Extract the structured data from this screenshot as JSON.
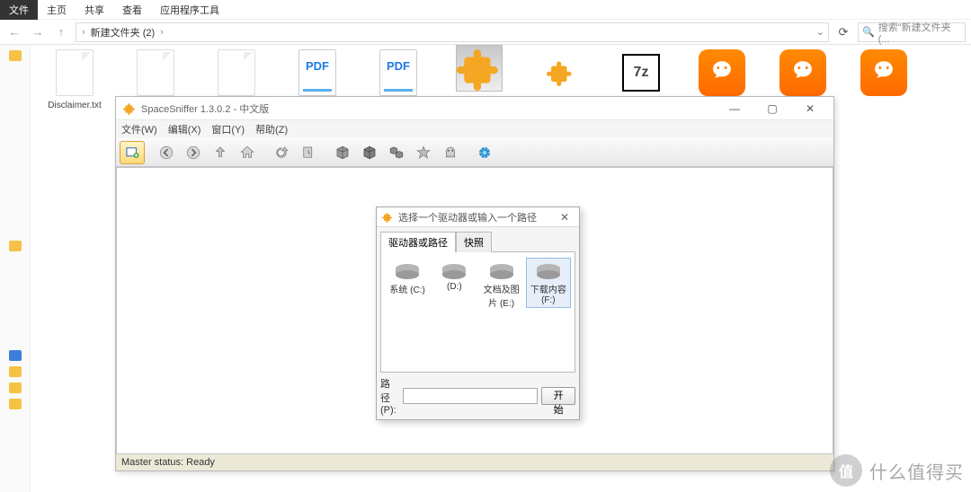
{
  "explorer": {
    "tabs": [
      "文件",
      "主页",
      "共享",
      "查看",
      "应用程序工具"
    ],
    "breadcrumb_item": "新建文件夹 (2)",
    "search_placeholder": "搜索\"新建文件夹 (..."
  },
  "files": {
    "disclaimer": "Disclaimer.txt"
  },
  "spacesniffer": {
    "title": "SpaceSniffer 1.3.0.2  -  中文版",
    "menu": {
      "file": "文件(W)",
      "edit": "编辑(X)",
      "window": "窗口(Y)",
      "help": "帮助(Z)"
    },
    "status": "Master status: Ready"
  },
  "dialog": {
    "title": "选择一个驱动器或输入一个路径",
    "tab_drives": "驱动器或路径",
    "tab_snapshot": "快照",
    "drives": [
      {
        "label": "系统 (C:)"
      },
      {
        "label": "(D:)"
      },
      {
        "label": "文档及图片 (E:)"
      },
      {
        "label": "下载内容 (F:)"
      }
    ],
    "path_label": "路径(P):",
    "path_value": "",
    "start": "开始"
  },
  "watermark": {
    "char": "值",
    "text": "什么值得买"
  }
}
